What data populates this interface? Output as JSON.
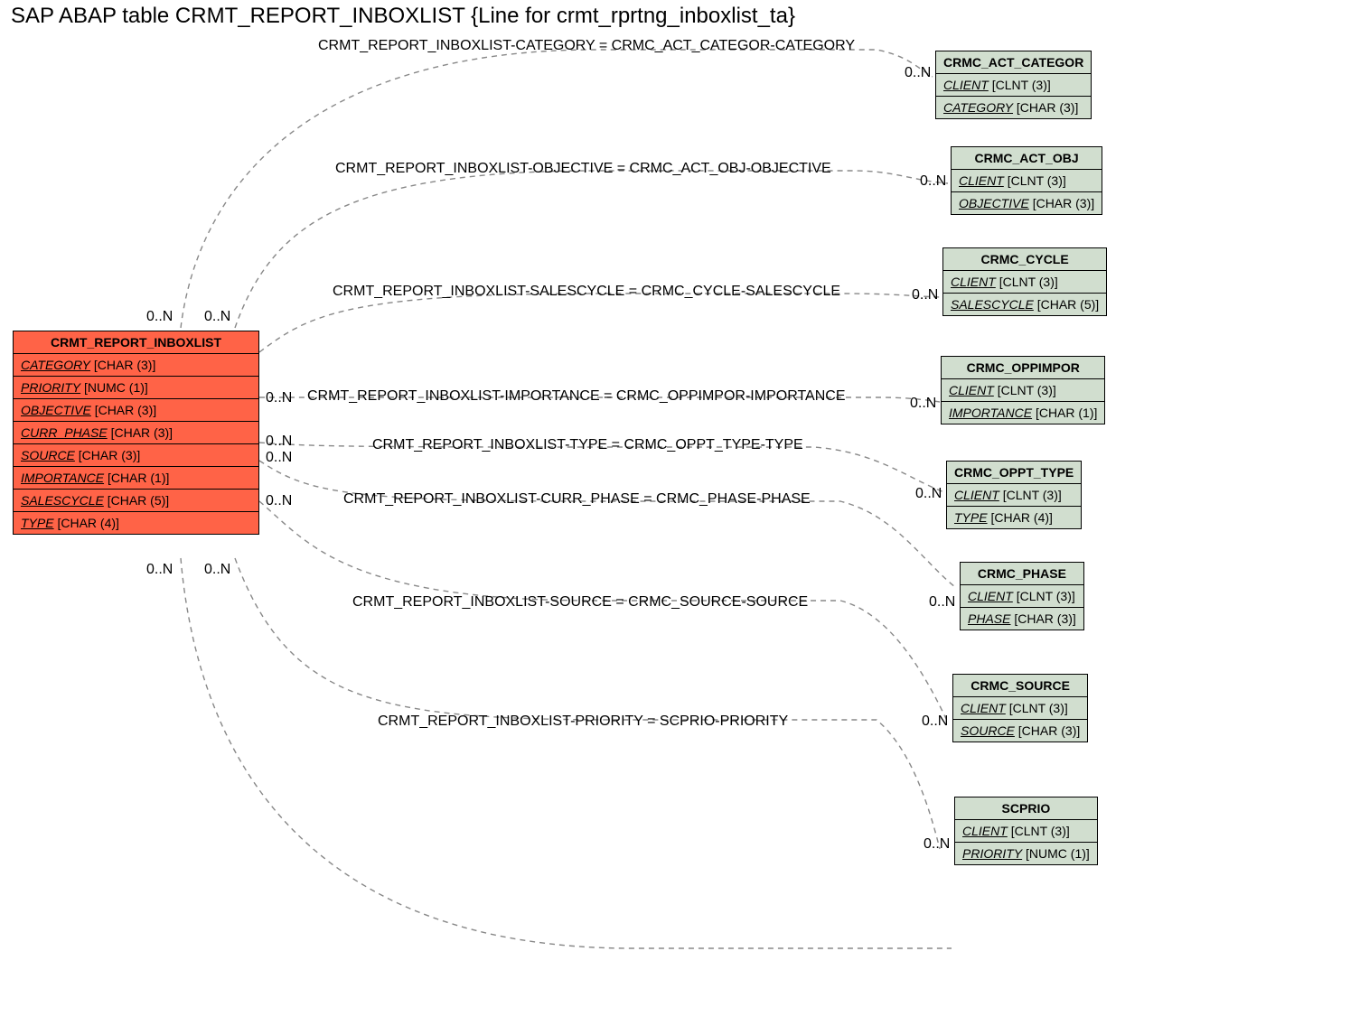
{
  "title": "SAP ABAP table CRMT_REPORT_INBOXLIST {Line for crmt_rprtng_inboxlist_ta}",
  "main": {
    "name": "CRMT_REPORT_INBOXLIST",
    "fields": [
      {
        "name": "CATEGORY",
        "type": "[CHAR (3)]"
      },
      {
        "name": "PRIORITY",
        "type": "[NUMC (1)]"
      },
      {
        "name": "OBJECTIVE",
        "type": "[CHAR (3)]"
      },
      {
        "name": "CURR_PHASE",
        "type": "[CHAR (3)]"
      },
      {
        "name": "SOURCE",
        "type": "[CHAR (3)]"
      },
      {
        "name": "IMPORTANCE",
        "type": "[CHAR (1)]"
      },
      {
        "name": "SALESCYCLE",
        "type": "[CHAR (5)]"
      },
      {
        "name": "TYPE",
        "type": "[CHAR (4)]"
      }
    ]
  },
  "refs": [
    {
      "name": "CRMC_ACT_CATEGOR",
      "fields": [
        {
          "name": "CLIENT",
          "type": "[CLNT (3)]"
        },
        {
          "name": "CATEGORY",
          "type": "[CHAR (3)]"
        }
      ]
    },
    {
      "name": "CRMC_ACT_OBJ",
      "fields": [
        {
          "name": "CLIENT",
          "type": "[CLNT (3)]"
        },
        {
          "name": "OBJECTIVE",
          "type": "[CHAR (3)]"
        }
      ]
    },
    {
      "name": "CRMC_CYCLE",
      "fields": [
        {
          "name": "CLIENT",
          "type": "[CLNT (3)]"
        },
        {
          "name": "SALESCYCLE",
          "type": "[CHAR (5)]"
        }
      ]
    },
    {
      "name": "CRMC_OPPIMPOR",
      "fields": [
        {
          "name": "CLIENT",
          "type": "[CLNT (3)]"
        },
        {
          "name": "IMPORTANCE",
          "type": "[CHAR (1)]"
        }
      ]
    },
    {
      "name": "CRMC_OPPT_TYPE",
      "fields": [
        {
          "name": "CLIENT",
          "type": "[CLNT (3)]"
        },
        {
          "name": "TYPE",
          "type": "[CHAR (4)]"
        }
      ]
    },
    {
      "name": "CRMC_PHASE",
      "fields": [
        {
          "name": "CLIENT",
          "type": "[CLNT (3)]"
        },
        {
          "name": "PHASE",
          "type": "[CHAR (3)]"
        }
      ]
    },
    {
      "name": "CRMC_SOURCE",
      "fields": [
        {
          "name": "CLIENT",
          "type": "[CLNT (3)]"
        },
        {
          "name": "SOURCE",
          "type": "[CHAR (3)]"
        }
      ]
    },
    {
      "name": "SCPRIO",
      "fields": [
        {
          "name": "CLIENT",
          "type": "[CLNT (3)]"
        },
        {
          "name": "PRIORITY",
          "type": "[NUMC (1)]"
        }
      ]
    }
  ],
  "rels": [
    {
      "label": "CRMT_REPORT_INBOXLIST-CATEGORY = CRMC_ACT_CATEGOR-CATEGORY"
    },
    {
      "label": "CRMT_REPORT_INBOXLIST-OBJECTIVE = CRMC_ACT_OBJ-OBJECTIVE"
    },
    {
      "label": "CRMT_REPORT_INBOXLIST-SALESCYCLE = CRMC_CYCLE-SALESCYCLE"
    },
    {
      "label": "CRMT_REPORT_INBOXLIST-IMPORTANCE = CRMC_OPPIMPOR-IMPORTANCE"
    },
    {
      "label": "CRMT_REPORT_INBOXLIST-TYPE = CRMC_OPPT_TYPE-TYPE"
    },
    {
      "label": "CRMT_REPORT_INBOXLIST-CURR_PHASE = CRMC_PHASE-PHASE"
    },
    {
      "label": "CRMT_REPORT_INBOXLIST-SOURCE = CRMC_SOURCE-SOURCE"
    },
    {
      "label": "CRMT_REPORT_INBOXLIST-PRIORITY = SCPRIO-PRIORITY"
    }
  ],
  "card_label": "0..N"
}
